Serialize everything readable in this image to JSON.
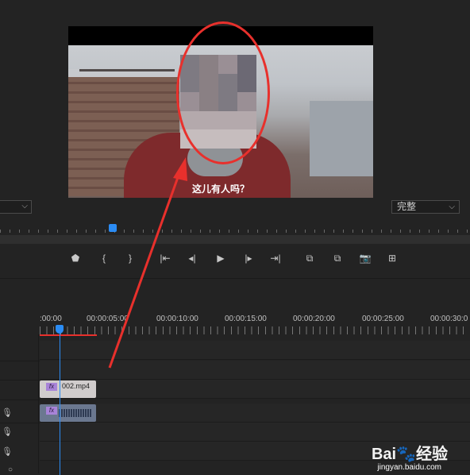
{
  "monitor": {
    "subtitle": "这儿有人吗？",
    "fit_label": "完整",
    "fit_chevron": "⌵",
    "left_chevron": "⌵"
  },
  "transport": {
    "buttons": [
      {
        "name": "add-marker",
        "glyph": "⬟"
      },
      {
        "name": "mark-in",
        "glyph": "{"
      },
      {
        "name": "mark-out",
        "glyph": "}"
      },
      {
        "name": "go-to-in",
        "glyph": "|⇤"
      },
      {
        "name": "step-back",
        "glyph": "◂|"
      },
      {
        "name": "play",
        "glyph": "▶"
      },
      {
        "name": "step-forward",
        "glyph": "|▸"
      },
      {
        "name": "go-to-out",
        "glyph": "⇥|"
      },
      {
        "name": "lift",
        "glyph": "⧉"
      },
      {
        "name": "extract",
        "glyph": "⧉"
      },
      {
        "name": "export-frame",
        "glyph": "📷"
      },
      {
        "name": "compare",
        "glyph": "⊞"
      }
    ]
  },
  "timeline": {
    "timecodes": [
      ":00:00",
      "00:00:05:00",
      "00:00:10:00",
      "00:00:15:00",
      "00:00:20:00",
      "00:00:25:00",
      "00:00:30:0"
    ],
    "video_clip": {
      "fx": "fx",
      "name": "002.mp4"
    },
    "audio_clip": {
      "fx": "fx"
    }
  },
  "watermark": {
    "brand": "Bai🐾经验",
    "url": "jingyan.baidu.com"
  },
  "colors": {
    "accent": "#2b8cf4",
    "annotation": "#e8302c",
    "background": "#232323"
  }
}
